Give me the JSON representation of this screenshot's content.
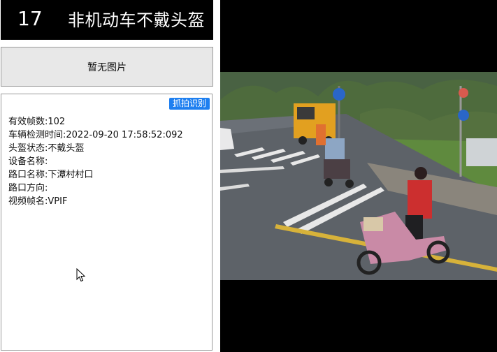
{
  "header": {
    "number": "17",
    "title": "非机动车不戴头盔"
  },
  "image_placeholder": {
    "label": "暂无图片"
  },
  "details": {
    "snap_button": "抓拍识别",
    "lines": [
      "有效帧数:102",
      "车辆检测时间:2022-09-20 17:58:52:092",
      "头盔状态:不戴头盔",
      "设备名称:",
      "路口名称:下潭村村口",
      "路口方向:",
      "视频帧名:VPIF"
    ]
  },
  "colors": {
    "title_bg": "#000000",
    "snap_button": "#1e7ff0",
    "placeholder_bg": "#e8e8e8"
  }
}
